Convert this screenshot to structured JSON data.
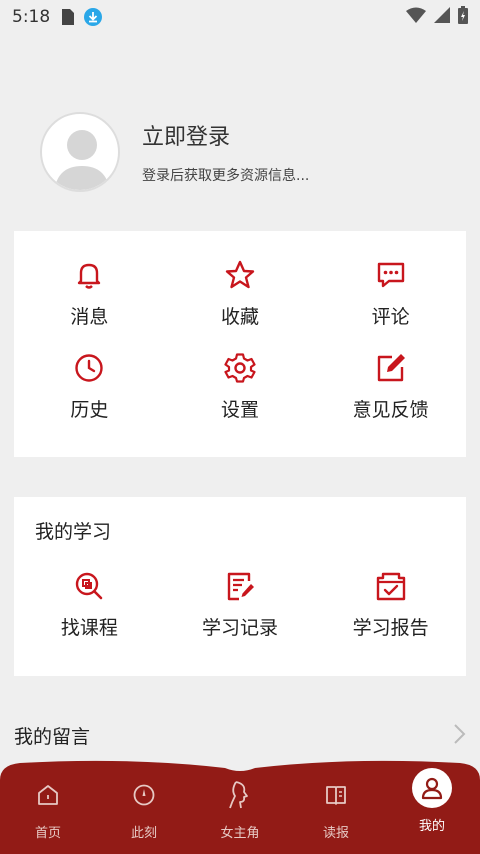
{
  "status_bar": {
    "time": "5:18"
  },
  "profile": {
    "title": "立即登录",
    "subtitle": "登录后获取更多资源信息..."
  },
  "actions": [
    {
      "label": "消息",
      "icon": "bell-icon"
    },
    {
      "label": "收藏",
      "icon": "star-icon"
    },
    {
      "label": "评论",
      "icon": "comment-icon"
    },
    {
      "label": "历史",
      "icon": "clock-icon"
    },
    {
      "label": "设置",
      "icon": "gear-icon"
    },
    {
      "label": "意见反馈",
      "icon": "edit-icon"
    }
  ],
  "study": {
    "title": "我的学习",
    "items": [
      {
        "label": "找课程",
        "icon": "search-course-icon"
      },
      {
        "label": "学习记录",
        "icon": "document-icon"
      },
      {
        "label": "学习报告",
        "icon": "report-icon"
      }
    ]
  },
  "messages": {
    "label": "我的留言"
  },
  "tabs": [
    {
      "label": "首页",
      "icon": "home-icon"
    },
    {
      "label": "此刻",
      "icon": "compass-icon"
    },
    {
      "label": "女主角",
      "icon": "woman-profile-icon"
    },
    {
      "label": "读报",
      "icon": "newspaper-icon"
    },
    {
      "label": "我的",
      "icon": "user-icon"
    }
  ],
  "colors": {
    "accent": "#c8161d",
    "tabbar": "#921b16",
    "background": "#efefef"
  }
}
